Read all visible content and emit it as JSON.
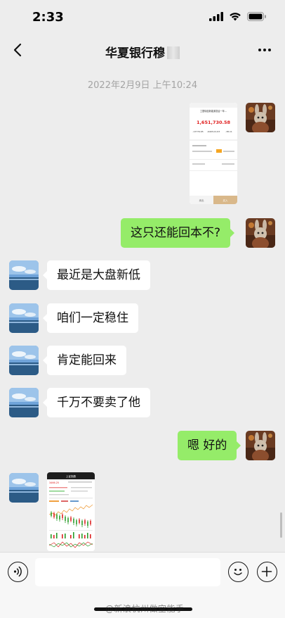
{
  "status_bar": {
    "time": "2:33"
  },
  "nav": {
    "title": "华夏银行穆"
  },
  "chat": {
    "timestamp": "2022年2月9日 上午10:24"
  },
  "screenshot1": {
    "header": "工银瑞信新能源混合一年...",
    "amount": "1,651,730.58",
    "stats": [
      "-13779.65",
      "-6403,01.63",
      "-38.11"
    ],
    "buy_label": "卖出",
    "sell_label": "买入"
  },
  "messages": [
    {
      "side": "right",
      "text": "这只还能回本不?"
    },
    {
      "side": "left",
      "text": "最近是大盘新低"
    },
    {
      "side": "left",
      "text": "咱们一定稳住"
    },
    {
      "side": "left",
      "text": "肯定能回来"
    },
    {
      "side": "left",
      "text": "千万不要卖了他"
    },
    {
      "side": "right",
      "text": "嗯 好的"
    }
  ],
  "screenshot2": {
    "header": "上证指数",
    "price": "3466.25"
  },
  "watermark": "@新浪杭州做空能手",
  "colors": {
    "self_bubble": "#95ec69",
    "other_bubble": "#ffffff",
    "background": "#ededed",
    "amount_red": "#e02020"
  }
}
